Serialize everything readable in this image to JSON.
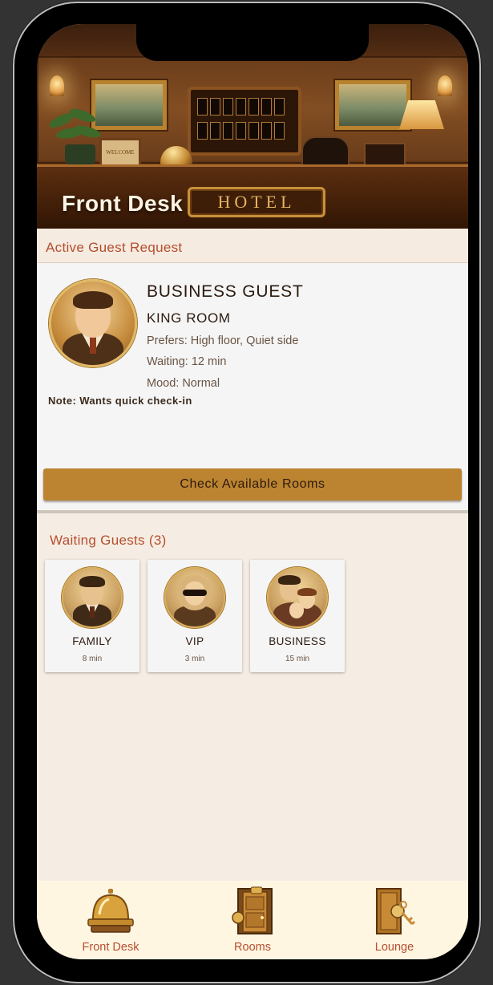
{
  "header": {
    "title": "Front Desk",
    "sign_text": "HOTEL",
    "welcome_sign": "WELCOME"
  },
  "active_request": {
    "section_label": "Active Guest Request",
    "guest_type": "BUSINESS GUEST",
    "room_type": "KING ROOM",
    "preferences": "Prefers: High floor, Quiet side",
    "waiting": "Waiting: 12 min",
    "mood": "Mood: Normal",
    "note": "Note: Wants quick check-in",
    "action_button": "Check Available Rooms"
  },
  "waiting_guests": {
    "section_label": "Waiting Guests (3)",
    "guests": [
      {
        "name": "FAMILY",
        "wait": "8 min"
      },
      {
        "name": "VIP",
        "wait": "3 min"
      },
      {
        "name": "BUSINESS",
        "wait": "15 min"
      }
    ]
  },
  "bottom_nav": {
    "items": [
      {
        "label": "Front Desk",
        "icon": "service-bell-icon"
      },
      {
        "label": "Rooms",
        "icon": "room-door-icon"
      },
      {
        "label": "Lounge",
        "icon": "door-key-icon"
      }
    ]
  },
  "colors": {
    "accent": "#b54e2f",
    "button": "#bc8430",
    "background": "#f5ede3",
    "card": "#f5f5f5",
    "nav_background": "#fff6e2"
  }
}
